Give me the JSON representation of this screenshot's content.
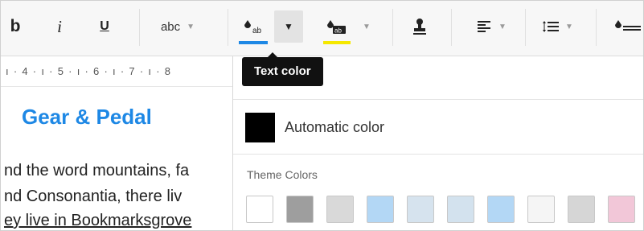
{
  "toolbar": {
    "bold_label": "b",
    "italic_label": "i",
    "underline_label": "U",
    "font_style_label": "abc",
    "text_color_bar": "#1e88e5",
    "highlight_color_bar": "#f5e800",
    "highlight_glyph": "ab",
    "text_color_glyph": "ab"
  },
  "ruler": {
    "text": "ı · 4 · ı · 5 · ı · 6 · ı · 7 · ı · 8"
  },
  "document": {
    "title": "Gear & Pedal",
    "lines": [
      "nd the word mountains, fa",
      "nd Consonantia, there liv",
      "ey live in Bookmarksgrove"
    ],
    "title_color": "#1e88e5"
  },
  "tooltip": {
    "text": "Text color"
  },
  "color_panel": {
    "automatic_label": "Automatic color",
    "theme_colors_label": "Theme Colors",
    "theme_colors": [
      "#ffffff",
      "#9e9e9e",
      "#d9d9d9",
      "#b3d7f5",
      "#d6e3ee",
      "#d3e2ee",
      "#b3d7f5",
      "#f5f5f5",
      "#d6d6d6",
      "#f2c7d8"
    ]
  }
}
